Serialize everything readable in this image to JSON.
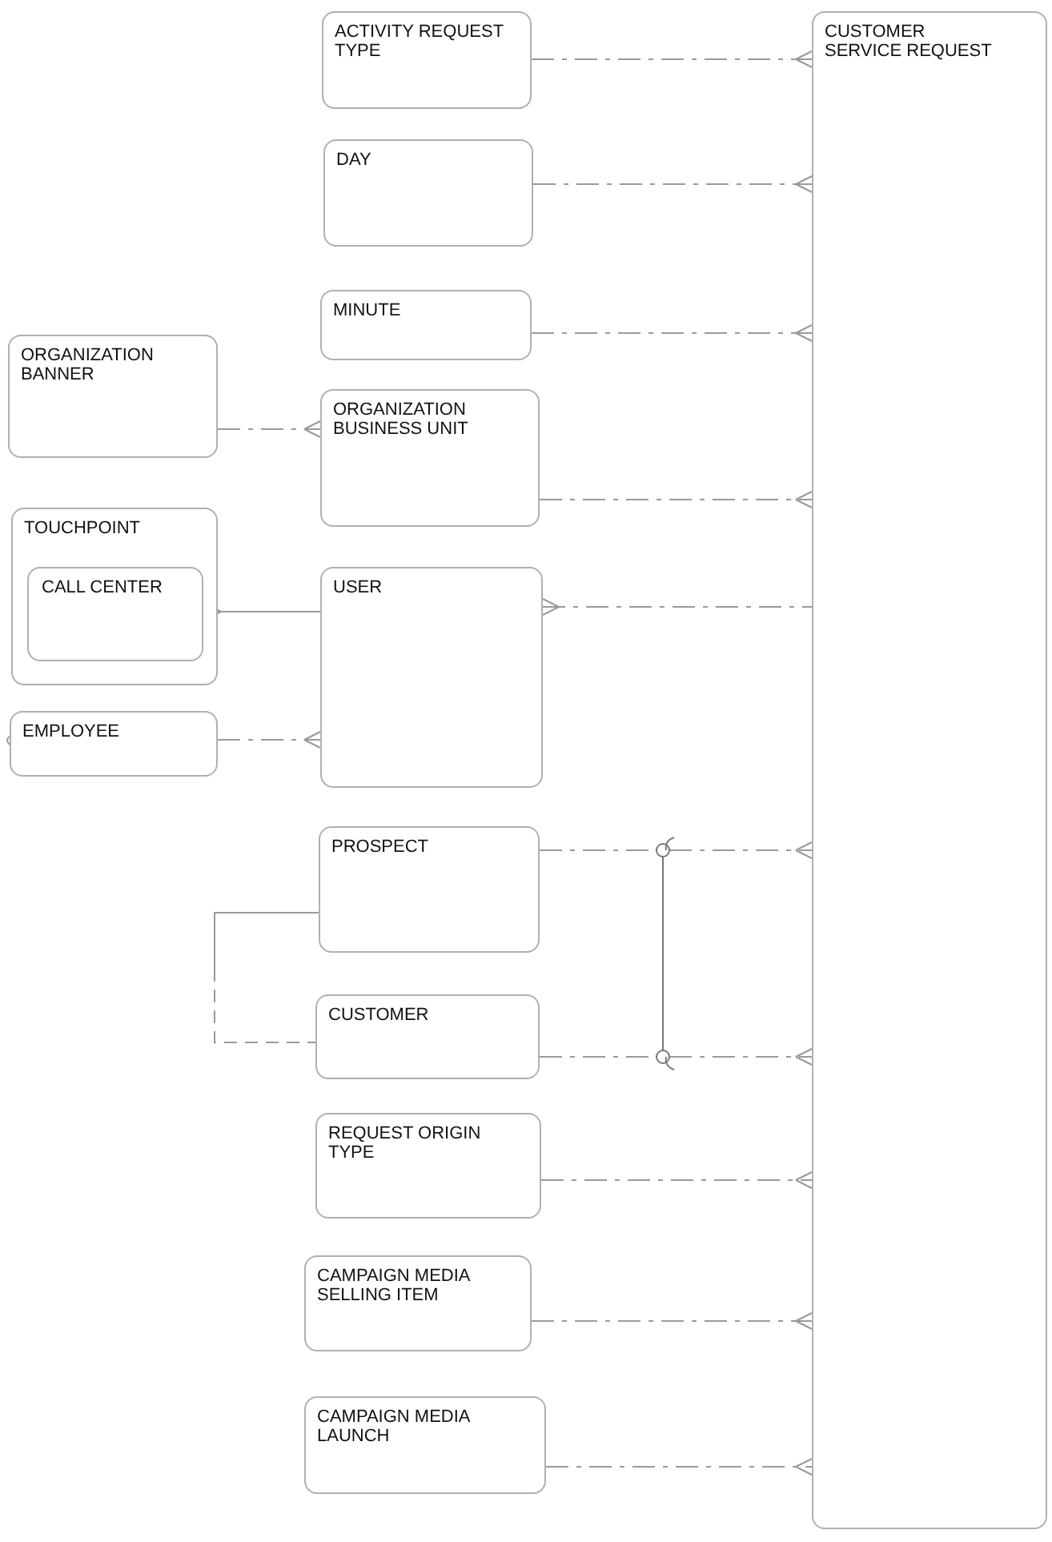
{
  "diagram": {
    "entities": [
      {
        "name": "ACTIVITY REQUEST TYPE"
      },
      {
        "name": "DAY"
      },
      {
        "name": "MINUTE"
      },
      {
        "name": "ORGANIZATION BANNER"
      },
      {
        "name": "ORGANIZATION BUSINESS UNIT"
      },
      {
        "name": "TOUCHPOINT",
        "children": [
          {
            "name": "CALL CENTER"
          }
        ]
      },
      {
        "name": "USER"
      },
      {
        "name": "EMPLOYEE"
      },
      {
        "name": "PROSPECT"
      },
      {
        "name": "CUSTOMER"
      },
      {
        "name": "REQUEST ORIGIN TYPE"
      },
      {
        "name": "CAMPAIGN MEDIA SELLING ITEM"
      },
      {
        "name": "CAMPAIGN MEDIA LAUNCH"
      },
      {
        "name": "CUSTOMER SERVICE REQUEST"
      }
    ]
  }
}
